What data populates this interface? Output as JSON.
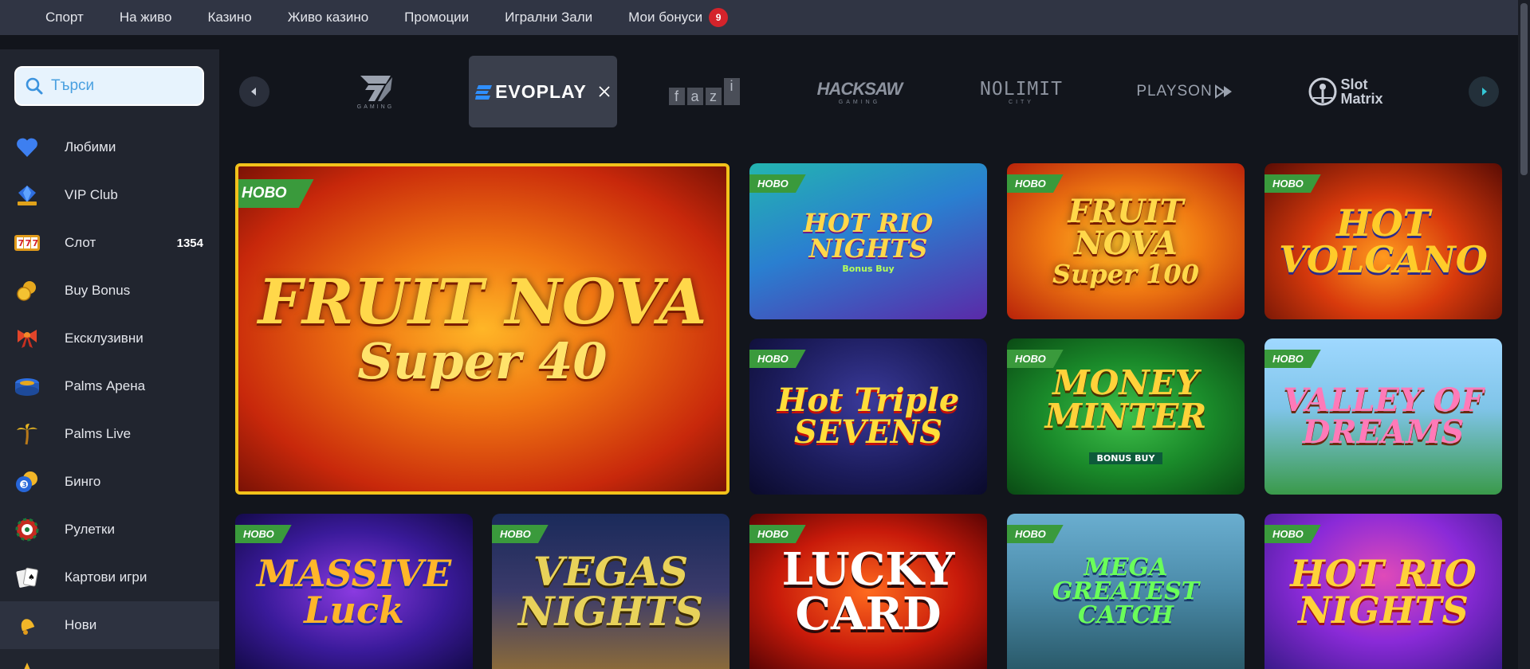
{
  "topnav": {
    "items": [
      "Спорт",
      "На живо",
      "Казино",
      "Живо казино",
      "Промоции",
      "Игрални Зали",
      "Мои бонуси"
    ],
    "bonus_badge": "9"
  },
  "sidebar": {
    "search_placeholder": "Търси",
    "items": [
      {
        "label": "Любими",
        "icon": "heart-icon"
      },
      {
        "label": "VIP Club",
        "icon": "jackpot-diamond-icon"
      },
      {
        "label": "Слот",
        "icon": "slot-777-icon",
        "count": "1354"
      },
      {
        "label": "Buy Bonus",
        "icon": "coins-icon"
      },
      {
        "label": "Ексклузивни",
        "icon": "bow-icon"
      },
      {
        "label": "Palms Арена",
        "icon": "arena-icon"
      },
      {
        "label": "Palms Live",
        "icon": "palm-icon"
      },
      {
        "label": "Бинго",
        "icon": "bingo-ball-icon"
      },
      {
        "label": "Рулетки",
        "icon": "roulette-icon"
      },
      {
        "label": "Картови игри",
        "icon": "cards-icon"
      },
      {
        "label": "Нови",
        "icon": "bell-icon"
      },
      {
        "label": "",
        "icon": "star-icon"
      }
    ]
  },
  "providers": [
    "7777 GAMING",
    "EVOPLAY",
    "fazi",
    "HACKSAW GAMING",
    "NOLIMIT CITY",
    "PLAYSON",
    "Slot Matrix"
  ],
  "new_tag": "НОВО",
  "games": [
    {
      "title": "FRUIT NOVA",
      "subtitle": "Super 40"
    },
    {
      "title": "HOT RIO NIGHTS",
      "subtitle": "Bonus Buy"
    },
    {
      "title": "FRUIT NOVA",
      "subtitle": "Super 100"
    },
    {
      "title": "HOT VOLCANO",
      "subtitle": ""
    },
    {
      "title": "Hot Triple SEVENS",
      "subtitle": ""
    },
    {
      "title": "MONEY MINTER",
      "subtitle": "BONUS BUY"
    },
    {
      "title": "VALLEY OF DREAMS",
      "subtitle": ""
    },
    {
      "title": "MASSIVE Luck",
      "subtitle": ""
    },
    {
      "title": "VEGAS NIGHTS",
      "subtitle": ""
    },
    {
      "title": "LUCKY CARD",
      "subtitle": ""
    },
    {
      "title": "MEGA GREATEST CATCH",
      "subtitle": ""
    },
    {
      "title": "HOT RIO NIGHTS",
      "subtitle": ""
    }
  ],
  "colors": {
    "accent_yellow": "#f2c21b",
    "tag_green": "#3a9a3c",
    "badge_red": "#d4232b"
  }
}
